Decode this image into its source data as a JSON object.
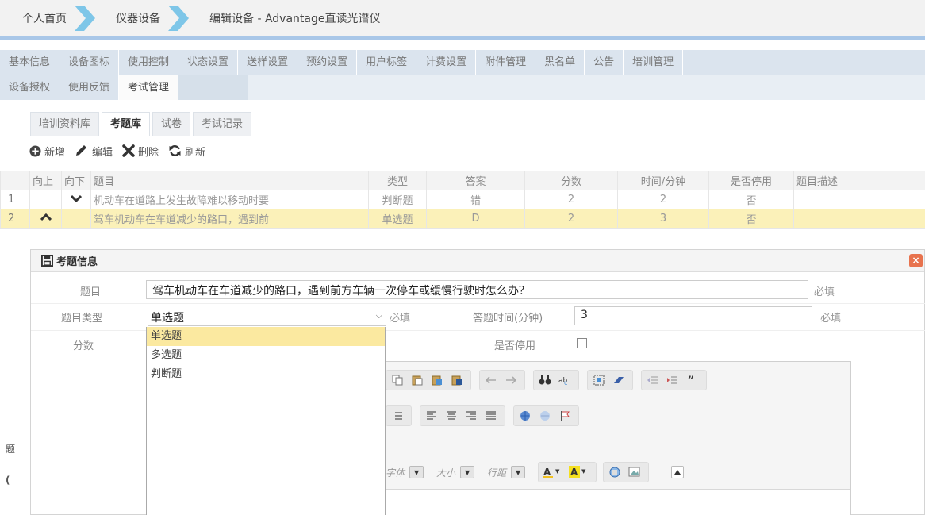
{
  "breadcrumb": [
    "个人首页",
    "仪器设备",
    "编辑设备 - Advantage直读光谱仪"
  ],
  "tabs_row1": [
    "基本信息",
    "设备图标",
    "使用控制",
    "状态设置",
    "送样设置",
    "预约设置",
    "用户标签",
    "计费设置",
    "附件管理",
    "黑名单",
    "公告",
    "培训管理"
  ],
  "tabs_row2": [
    "设备授权",
    "使用反馈",
    "考试管理"
  ],
  "active_tab": "考试管理",
  "subtabs": [
    "培训资料库",
    "考题库",
    "试卷",
    "考试记录"
  ],
  "active_subtab": "考题库",
  "toolbar": {
    "add": "新增",
    "edit": "编辑",
    "delete": "删除",
    "refresh": "刷新"
  },
  "grid": {
    "headers": [
      "",
      "向上",
      "向下",
      "题目",
      "类型",
      "答案",
      "分数",
      "时间/分钟",
      "是否停用",
      "题目描述"
    ],
    "rows": [
      {
        "num": "1",
        "title": "机动车在道路上发生故障难以移动时要",
        "type": "判断题",
        "answer": "错",
        "score": "2",
        "time": "2",
        "disabled": "否",
        "desc": ""
      },
      {
        "num": "2",
        "title": "驾车机动车在车道减少的路口，遇到前",
        "type": "单选题",
        "answer": "D",
        "score": "2",
        "time": "3",
        "disabled": "否",
        "desc": ""
      }
    ]
  },
  "dialog": {
    "title": "考题信息",
    "close": "×",
    "label_question": "题目",
    "question_value": "驾车机动车在车道减少的路口，遇到前方车辆一次停车或缓慢行驶时怎么办？",
    "required": "必填",
    "label_type": "题目类型",
    "type_value": "单选题",
    "type_options": [
      "单选题",
      "多选题",
      "判断题"
    ],
    "label_time": "答题时间(分钟)",
    "time_value": "3",
    "label_score": "分数",
    "label_disabled": "是否停用",
    "editor": {
      "font_label": "字体",
      "size_label": "大小",
      "lineheight_label": "行距"
    }
  },
  "left_edge_glyphs": [
    "题",
    "("
  ],
  "colors": {
    "tabbar": "#dbe4ee",
    "breadcrumb_line": "#a9c7e8",
    "selected_row": "#fbf1b9",
    "dropdown_highlight": "#fbe9a0",
    "close_button": "#e8734e"
  }
}
